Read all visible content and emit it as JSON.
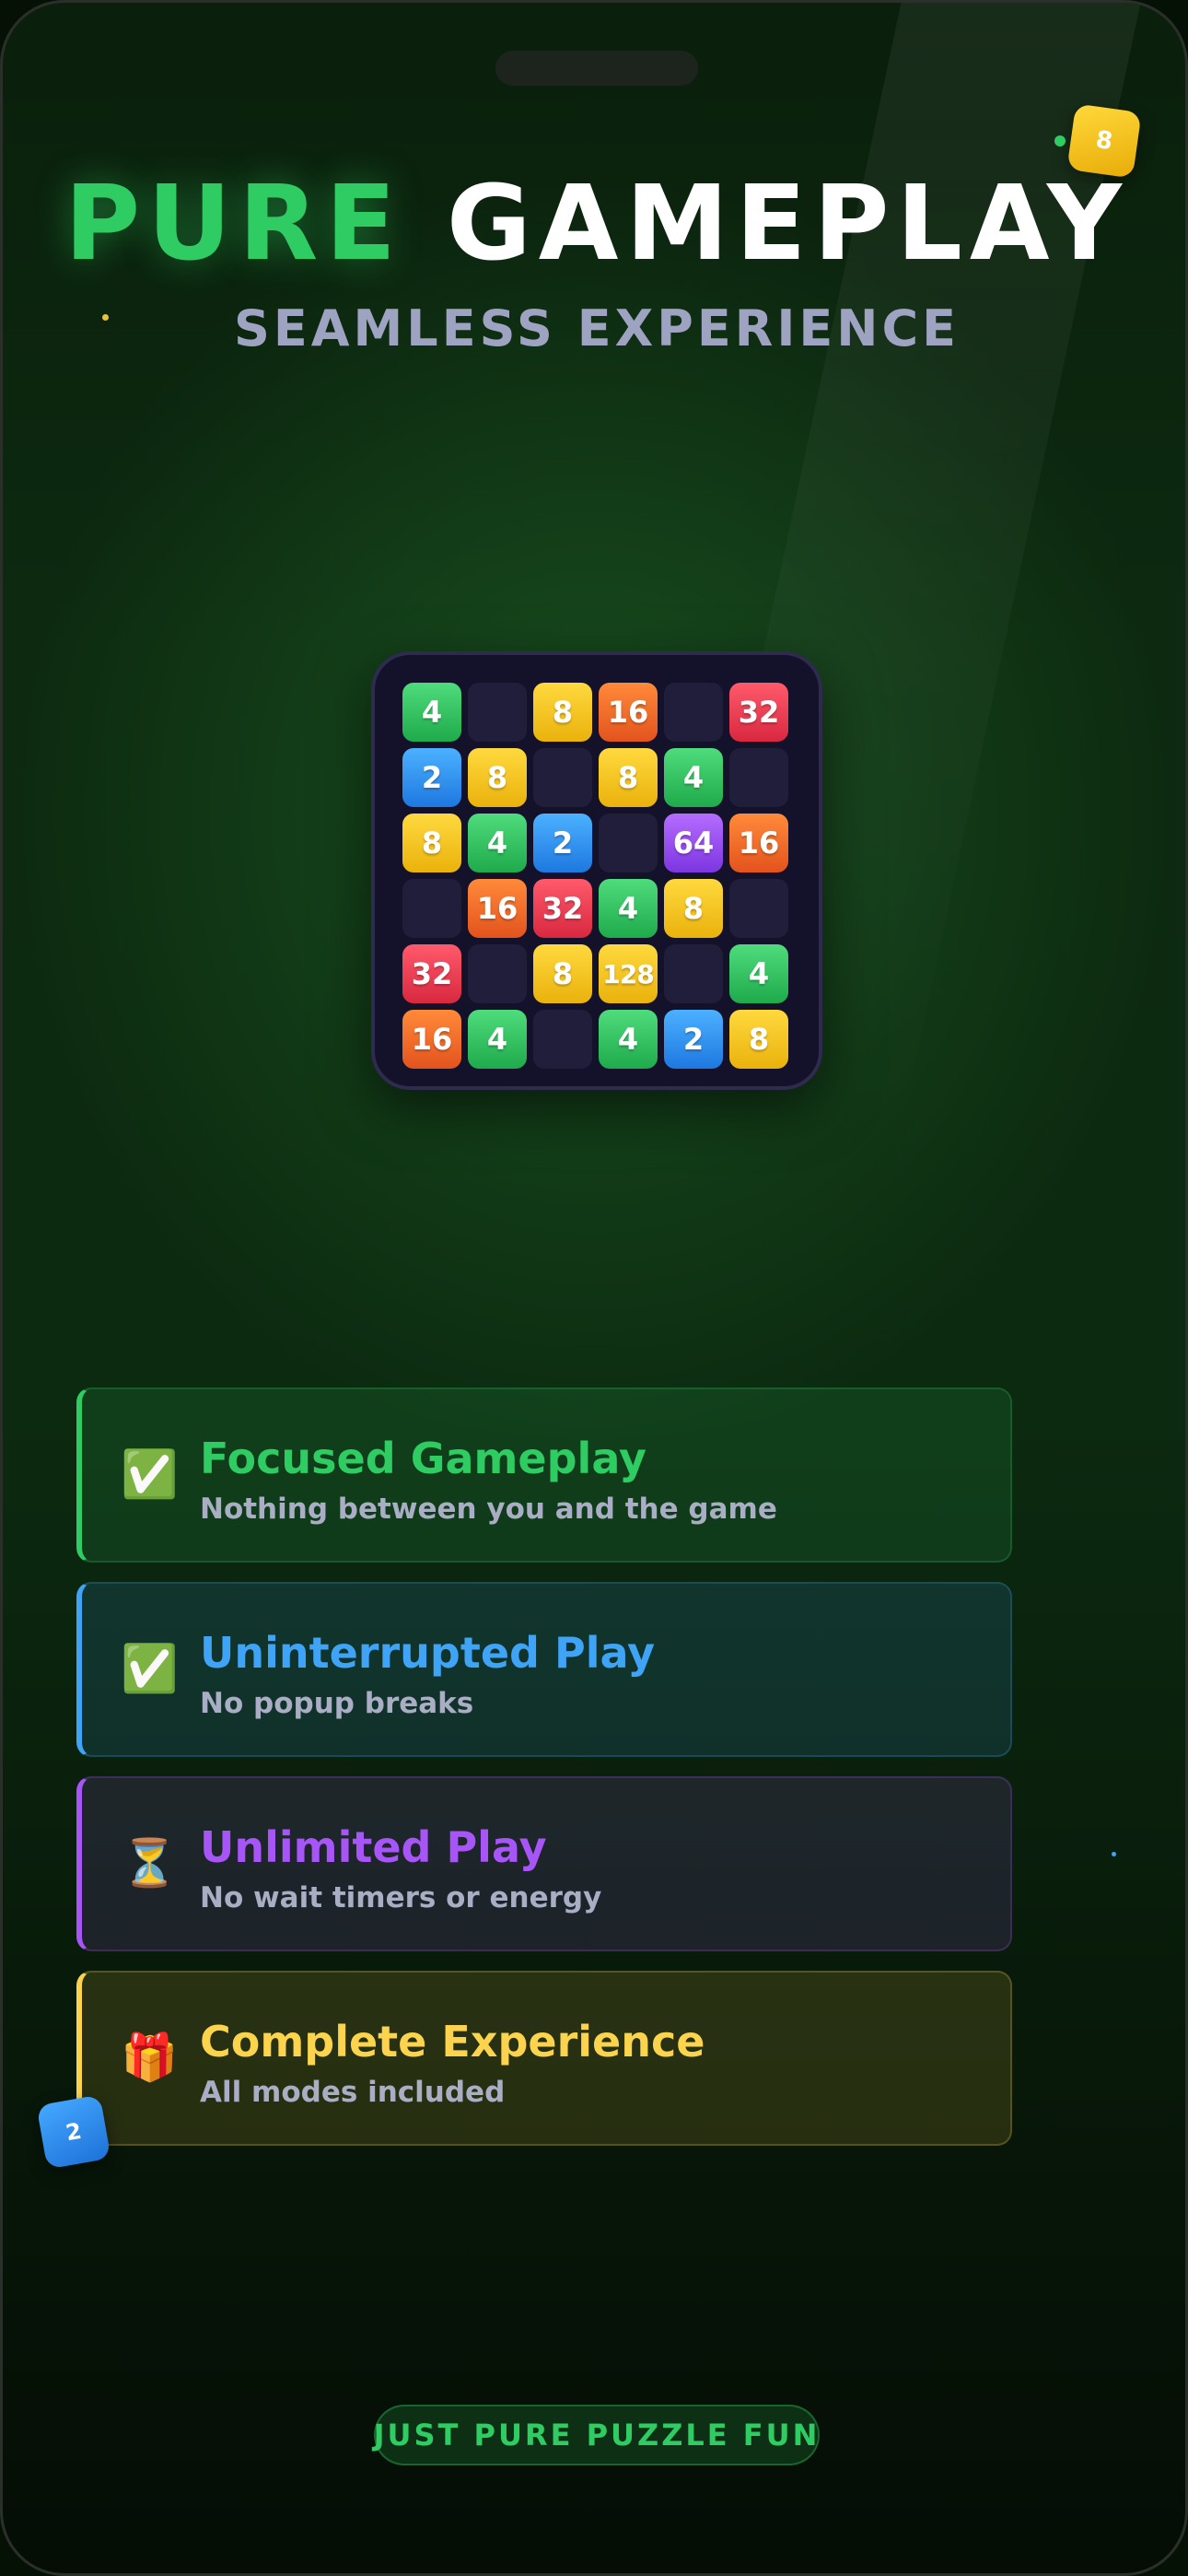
{
  "header": {
    "title_word1": "PURE",
    "title_word2": "GAMEPLAY",
    "subtitle": "SEAMLESS EXPERIENCE"
  },
  "floating_tiles": {
    "top_right": "8",
    "bottom_left": "2"
  },
  "board": {
    "rows": [
      [
        "4",
        "",
        "8",
        "16",
        "",
        "32"
      ],
      [
        "2",
        "8",
        "",
        "8",
        "4",
        ""
      ],
      [
        "8",
        "4",
        "2",
        "",
        "64",
        "16"
      ],
      [
        "",
        "16",
        "32",
        "4",
        "8",
        ""
      ],
      [
        "32",
        "",
        "8",
        "128",
        "",
        "4"
      ],
      [
        "16",
        "4",
        "",
        "4",
        "2",
        "8"
      ]
    ]
  },
  "features": [
    {
      "icon": "check-mark-icon",
      "glyph": "✅",
      "title": "Focused Gameplay",
      "description": "Nothing between you and the game",
      "color": "#2ecc62"
    },
    {
      "icon": "check-mark-icon",
      "glyph": "✅",
      "title": "Uninterrupted Play",
      "description": "No popup breaks",
      "color": "#3fa4f5"
    },
    {
      "icon": "hourglass-icon",
      "glyph": "⏳",
      "title": "Unlimited Play",
      "description": "No wait timers or energy",
      "color": "#a855f7"
    },
    {
      "icon": "gift-icon",
      "glyph": "🎁",
      "title": "Complete Experience",
      "description": "All modes included",
      "color": "#fcd34d"
    }
  ],
  "footer": {
    "tagline": "JUST PURE PUZZLE FUN"
  },
  "colors": {
    "accent_green": "#2ecc62",
    "accent_blue": "#3fa4f5",
    "accent_purple": "#a855f7",
    "accent_yellow": "#fcd34d",
    "subtitle_gray": "#9ea3c2"
  }
}
